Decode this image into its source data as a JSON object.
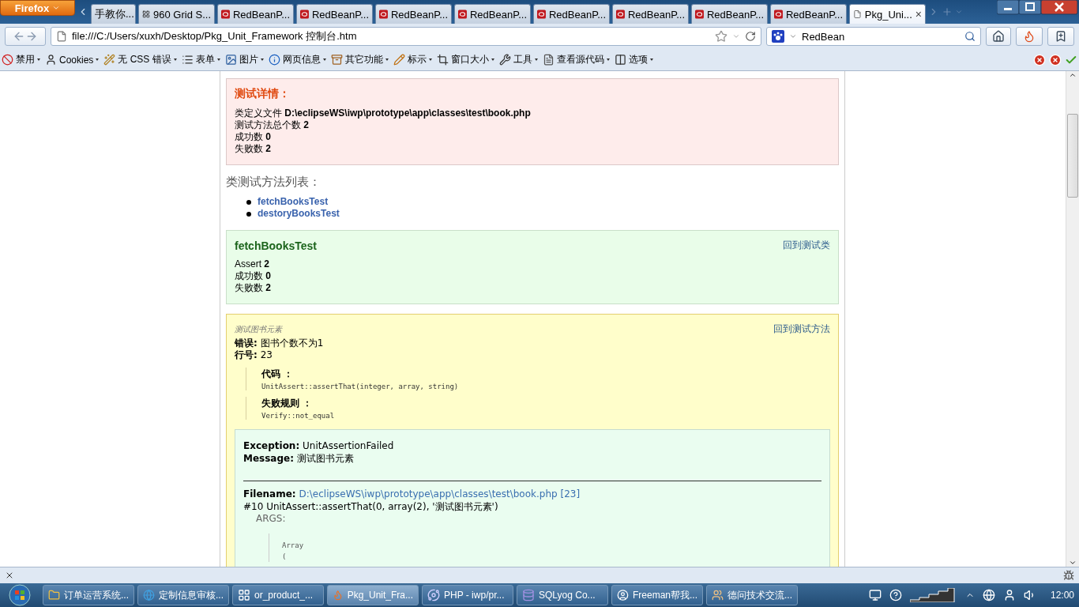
{
  "browser": {
    "app_button": "Firefox",
    "tabs": [
      {
        "label": "手教你...",
        "kind": "none",
        "selected": false
      },
      {
        "label": "960 Grid S...",
        "kind": "grid",
        "selected": false
      },
      {
        "label": "RedBeanP...",
        "kind": "redbean",
        "selected": false
      },
      {
        "label": "RedBeanP...",
        "kind": "redbean",
        "selected": false
      },
      {
        "label": "RedBeanP...",
        "kind": "redbean",
        "selected": false
      },
      {
        "label": "RedBeanP...",
        "kind": "redbean",
        "selected": false
      },
      {
        "label": "RedBeanP...",
        "kind": "redbean",
        "selected": false
      },
      {
        "label": "RedBeanP...",
        "kind": "redbean",
        "selected": false
      },
      {
        "label": "RedBeanP...",
        "kind": "redbean",
        "selected": false
      },
      {
        "label": "RedBeanP...",
        "kind": "redbean",
        "selected": false
      },
      {
        "label": "Pkg_Uni...",
        "kind": "page",
        "selected": true,
        "close": "×"
      }
    ],
    "url": "file:///C:/Users/xuxh/Desktop/Pkg_Unit_Framework 控制台.htm",
    "search": "RedBean",
    "addons": [
      {
        "label": "禁用",
        "kind": "ban"
      },
      {
        "label": "Cookies",
        "kind": "user"
      },
      {
        "label": "无 CSS 错误",
        "kind": "wand"
      },
      {
        "label": "表单",
        "kind": "list"
      },
      {
        "label": "图片",
        "kind": "image"
      },
      {
        "label": "网页信息",
        "kind": "info"
      },
      {
        "label": "其它功能",
        "kind": "box"
      },
      {
        "label": "标示",
        "kind": "pencil"
      },
      {
        "label": "窗口大小",
        "kind": "crop"
      },
      {
        "label": "工具",
        "kind": "tools"
      },
      {
        "label": "查看源代码",
        "kind": "page"
      },
      {
        "label": "选项",
        "kind": "panel"
      }
    ]
  },
  "page": {
    "details": {
      "title": "测试详情：",
      "lines": [
        "类定义文件 **D:\\eclipseWS\\iwp\\prototype\\app\\classes\\test\\book.php**",
        "测试方法总个数 **2**",
        "成功数 **0**",
        "失败数 **2**"
      ]
    },
    "methods": {
      "heading": "类测试方法列表：",
      "items": [
        "fetchBooksTest",
        "destoryBooksTest"
      ]
    },
    "method_card": {
      "title": "fetchBooksTest",
      "link": "回到测试类",
      "lines": [
        "Assert **2**",
        "成功数 **0**",
        "失败数 **2**"
      ]
    },
    "failure": {
      "caption": "测试图书元素",
      "link": "回到测试方法",
      "fields": [
        "**错误:** 图书个数不为1",
        "**行号:** 23"
      ],
      "blocks": [
        {
          "label": "代码 ：",
          "code": "UnitAssert::assertThat(integer, array, string)"
        },
        {
          "label": "失败规则 ：",
          "code": "Verify::not_equal"
        }
      ],
      "exception": {
        "fields": [
          "**Exception:** UnitAssertionFailed",
          "**Message:** 测试图书元素"
        ],
        "filename_label": "Filename:",
        "filename": "D:\\eclipseWS\\iwp\\prototype\\app\\classes\\test\\book.php [23]",
        "trace": "#10 UnitAssert::assertThat(0, array(2), '测试图书元素')",
        "args_label": "ARGS:",
        "args_lines": [
          "Array",
          "("
        ]
      }
    }
  },
  "taskbar": {
    "items": [
      {
        "label": "订单运营系统...",
        "kind": "folder",
        "selected": false
      },
      {
        "label": "定制信息审核...",
        "kind": "ie",
        "selected": false
      },
      {
        "label": "or_product_...",
        "kind": "app",
        "selected": false
      },
      {
        "label": "Pkg_Unit_Fra...",
        "kind": "firefox",
        "selected": true
      },
      {
        "label": "PHP - iwp/pr...",
        "kind": "eclipse",
        "selected": false
      },
      {
        "label": "SQLyog Co...",
        "kind": "sqlyog",
        "selected": false
      },
      {
        "label": "Freeman帮我...",
        "kind": "avatar",
        "selected": false
      },
      {
        "label": "德问技术交流...",
        "kind": "chat",
        "selected": false
      }
    ],
    "clock": "12:00"
  }
}
